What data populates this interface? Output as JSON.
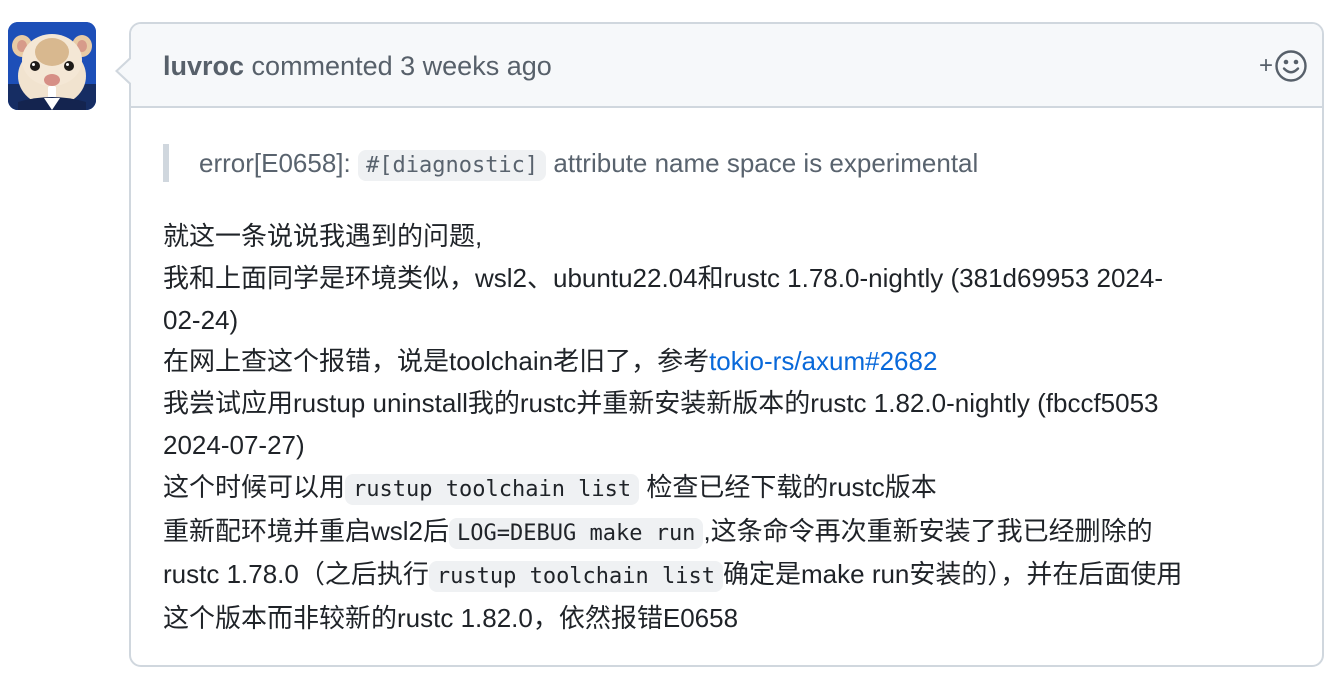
{
  "comment": {
    "author": "luvroc",
    "action": "commented",
    "time": "3 weeks ago",
    "reaction_plus": "+",
    "quote": {
      "prefix": "error[E0658]: ",
      "code": "#[diagnostic]",
      "suffix": " attribute name space is experimental"
    },
    "lines": {
      "l1": "就这一条说说我遇到的问题,",
      "l2": "我和上面同学是环境类似，wsl2、ubuntu22.04和rustc 1.78.0-nightly (381d69953 2024-",
      "l3": "02-24)",
      "l4_prefix": "在网上查这个报错，说是toolchain老旧了，参考",
      "l4_link": "tokio-rs/axum#2682",
      "l5": "我尝试应用rustup uninstall我的rustc并重新安装新版本的rustc 1.82.0-nightly (fbccf5053",
      "l6": "2024-07-27)",
      "l7_prefix": "这个时候可以用",
      "l7_code": "rustup toolchain list",
      "l7_suffix": "检查已经下载的rustc版本",
      "l8_prefix": "重新配环境并重启wsl2后",
      "l8_code": "LOG=DEBUG make run",
      "l8_suffix": ",这条命令再次重新安装了我已经删除的",
      "l9_prefix": "rustc 1.78.0（之后执行",
      "l9_code": "rustup toolchain list",
      "l9_suffix": "确定是make run安装的），并在后面使用",
      "l10": "这个版本而非较新的rustc 1.82.0，依然报错E0658"
    }
  },
  "colors": {
    "border": "#d0d7de",
    "header_bg": "#f6f8fa",
    "link": "#0969da",
    "code_bg": "#eff1f3"
  },
  "icons": {
    "avatar": "hamster-avatar",
    "reaction": "smiley-icon"
  }
}
